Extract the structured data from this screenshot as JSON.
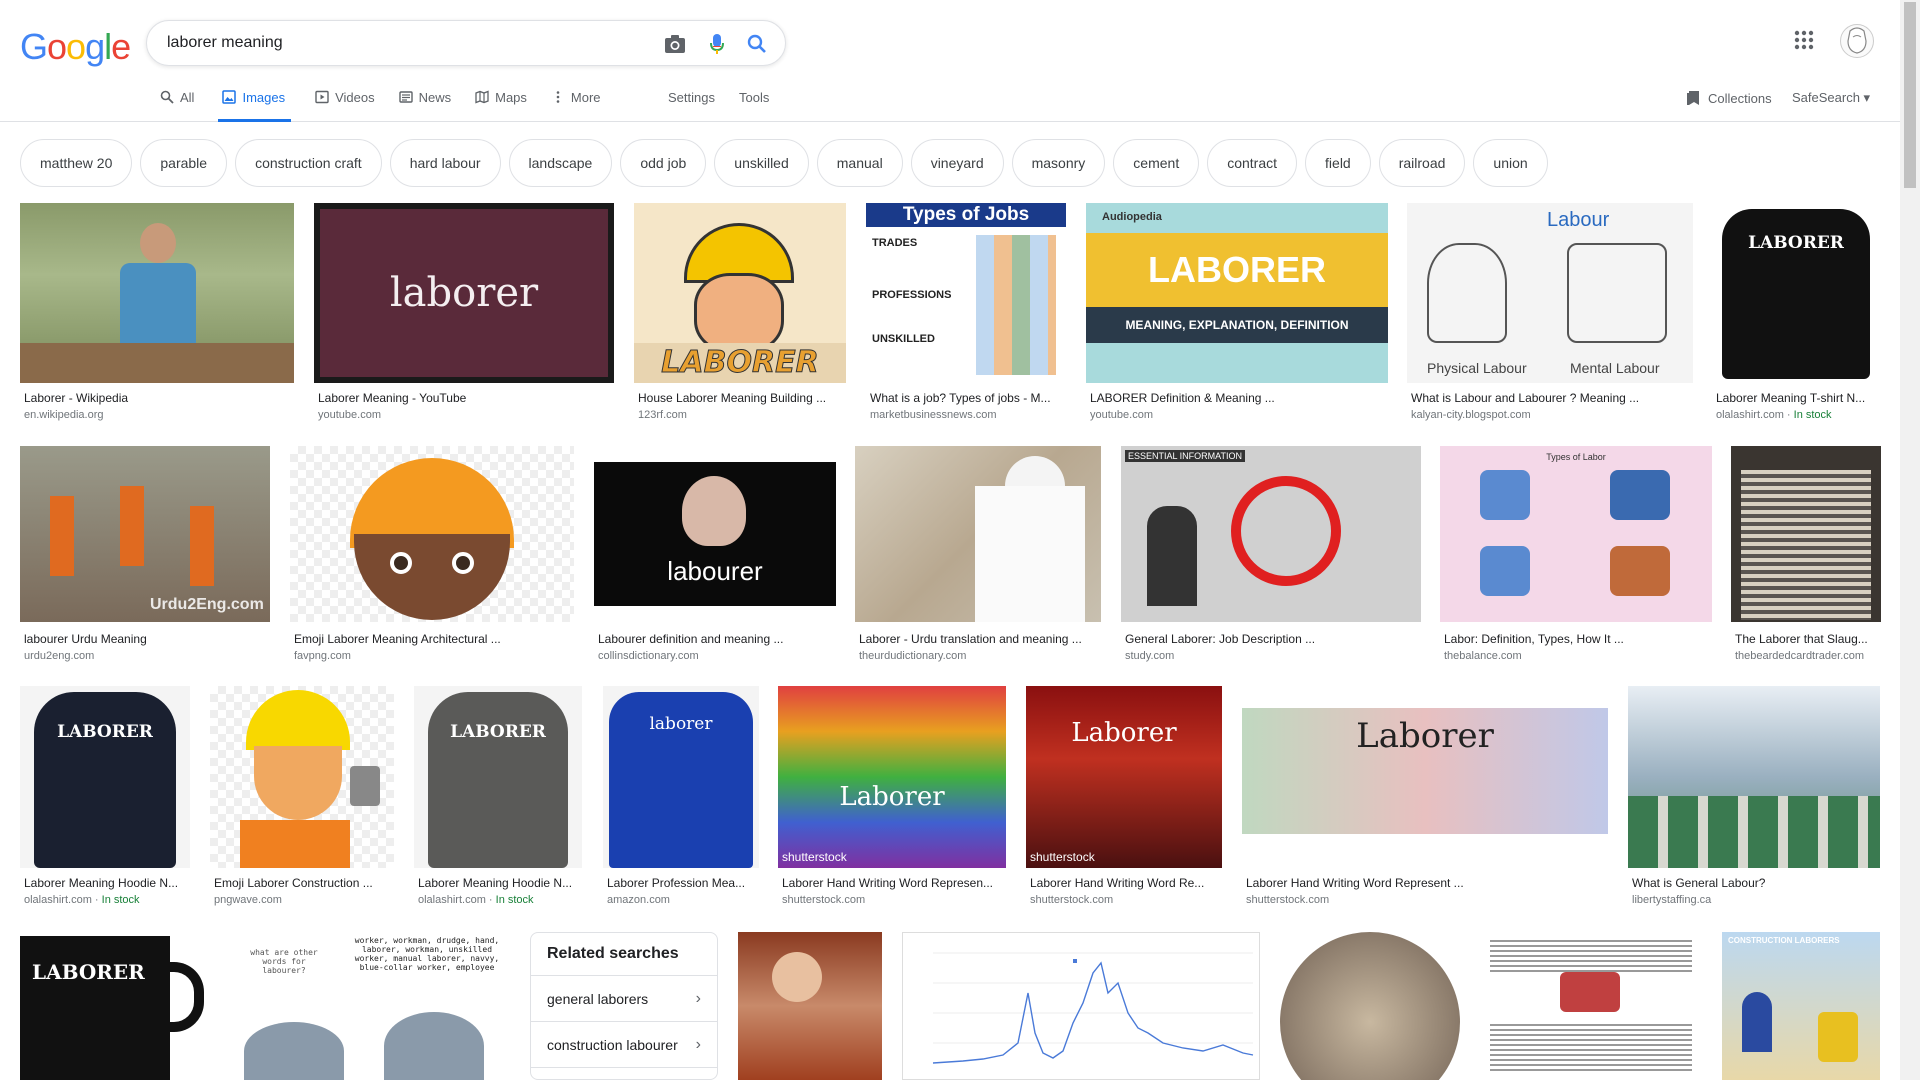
{
  "logo": {
    "letters": [
      "G",
      "o",
      "o",
      "g",
      "l",
      "e"
    ],
    "colors": [
      "#4285f4",
      "#ea4335",
      "#fbbc05",
      "#4285f4",
      "#34a853",
      "#ea4335"
    ]
  },
  "search": {
    "query": "laborer meaning"
  },
  "tabs": [
    {
      "label": "All",
      "icon": "search-icon"
    },
    {
      "label": "Images",
      "icon": "image-icon"
    },
    {
      "label": "Videos",
      "icon": "video-icon"
    },
    {
      "label": "News",
      "icon": "news-icon"
    },
    {
      "label": "Maps",
      "icon": "map-icon"
    },
    {
      "label": "More",
      "icon": "more-icon"
    }
  ],
  "tools": {
    "settings": "Settings",
    "tools": "Tools",
    "collections": "Collections",
    "safesearch": "SafeSearch ▾"
  },
  "chips": [
    "matthew 20",
    "parable",
    "construction craft",
    "hard labour",
    "landscape",
    "odd job",
    "unskilled",
    "manual",
    "vineyard",
    "masonry",
    "cement",
    "contract",
    "field",
    "railroad",
    "union"
  ],
  "results": [
    {
      "caption": "Laborer - Wikipedia",
      "source": "en.wikipedia.org",
      "stock": ""
    },
    {
      "caption": "Laborer Meaning - YouTube",
      "source": "youtube.com",
      "stock": ""
    },
    {
      "caption": "House Laborer Meaning Building ...",
      "source": "123rf.com",
      "stock": ""
    },
    {
      "caption": "What is a job? Types of jobs - M...",
      "source": "marketbusinessnews.com",
      "stock": ""
    },
    {
      "caption": "LABORER Definition & Meaning ...",
      "source": "youtube.com",
      "stock": ""
    },
    {
      "caption": "What is Labour and Labourer ? Meaning ...",
      "source": "kalyan-city.blogspot.com",
      "stock": ""
    },
    {
      "caption": "Laborer Meaning T-shirt N...",
      "source": "olalashirt.com",
      "stock": "In stock"
    },
    {
      "caption": "labourer Urdu Meaning",
      "source": "urdu2eng.com",
      "stock": ""
    },
    {
      "caption": "Emoji Laborer Meaning Architectural ...",
      "source": "favpng.com",
      "stock": ""
    },
    {
      "caption": "Labourer definition and meaning ...",
      "source": "collinsdictionary.com",
      "stock": ""
    },
    {
      "caption": "Laborer - Urdu translation and meaning ...",
      "source": "theurdudictionary.com",
      "stock": ""
    },
    {
      "caption": "General Laborer: Job Description ...",
      "source": "study.com",
      "stock": ""
    },
    {
      "caption": "Labor: Definition, Types, How It ...",
      "source": "thebalance.com",
      "stock": ""
    },
    {
      "caption": "The Laborer that Slaug...",
      "source": "thebeardedcardtrader.com",
      "stock": ""
    },
    {
      "caption": "Laborer Meaning Hoodie N...",
      "source": "olalashirt.com",
      "stock": "In stock"
    },
    {
      "caption": "Emoji Laborer Construction ...",
      "source": "pngwave.com",
      "stock": ""
    },
    {
      "caption": "Laborer Meaning Hoodie N...",
      "source": "olalashirt.com",
      "stock": "In stock"
    },
    {
      "caption": "Laborer Profession Mea...",
      "source": "amazon.com",
      "stock": ""
    },
    {
      "caption": "Laborer Hand Writing Word Represen...",
      "source": "shutterstock.com",
      "stock": ""
    },
    {
      "caption": "Laborer Hand Writing Word Re...",
      "source": "shutterstock.com",
      "stock": ""
    },
    {
      "caption": "Laborer Hand Writing Word Represent ...",
      "source": "shutterstock.com",
      "stock": ""
    },
    {
      "caption": "What is General Labour?",
      "source": "libertystaffing.ca",
      "stock": ""
    }
  ],
  "thumb_text": {
    "laborer_word": "laborer",
    "laborer_caps": "LABORER",
    "types_of_jobs": "Types of Jobs",
    "trades": "TRADES",
    "professions": "PROFESSIONS",
    "unskilled": "UNSKILLED",
    "audiopedia": "Audiopedia",
    "mep": "MEANING, EXPLANATION, DEFINITION",
    "labour": "Labour",
    "physical": "Physical Labour",
    "mental": "Mental Labour",
    "urdu2eng": "Urdu2Eng.com",
    "labourer": "labourer",
    "essential": "ESSENTIAL INFORMATION",
    "types_of_labor": "Types of Labor",
    "laborer_mixed": "Laborer",
    "shutterstock": "shutterstock",
    "pigeon_q": "what are other words for labourer?",
    "pigeon_a": "worker, workman, drudge, hand, laborer, workman, unskilled worker, manual laborer, navvy, blue-collar worker, employee",
    "construction_laborers": "CONSTRUCTION LABORERS"
  },
  "related": {
    "title": "Related searches",
    "items": [
      "general laborers",
      "construction labourer"
    ]
  }
}
